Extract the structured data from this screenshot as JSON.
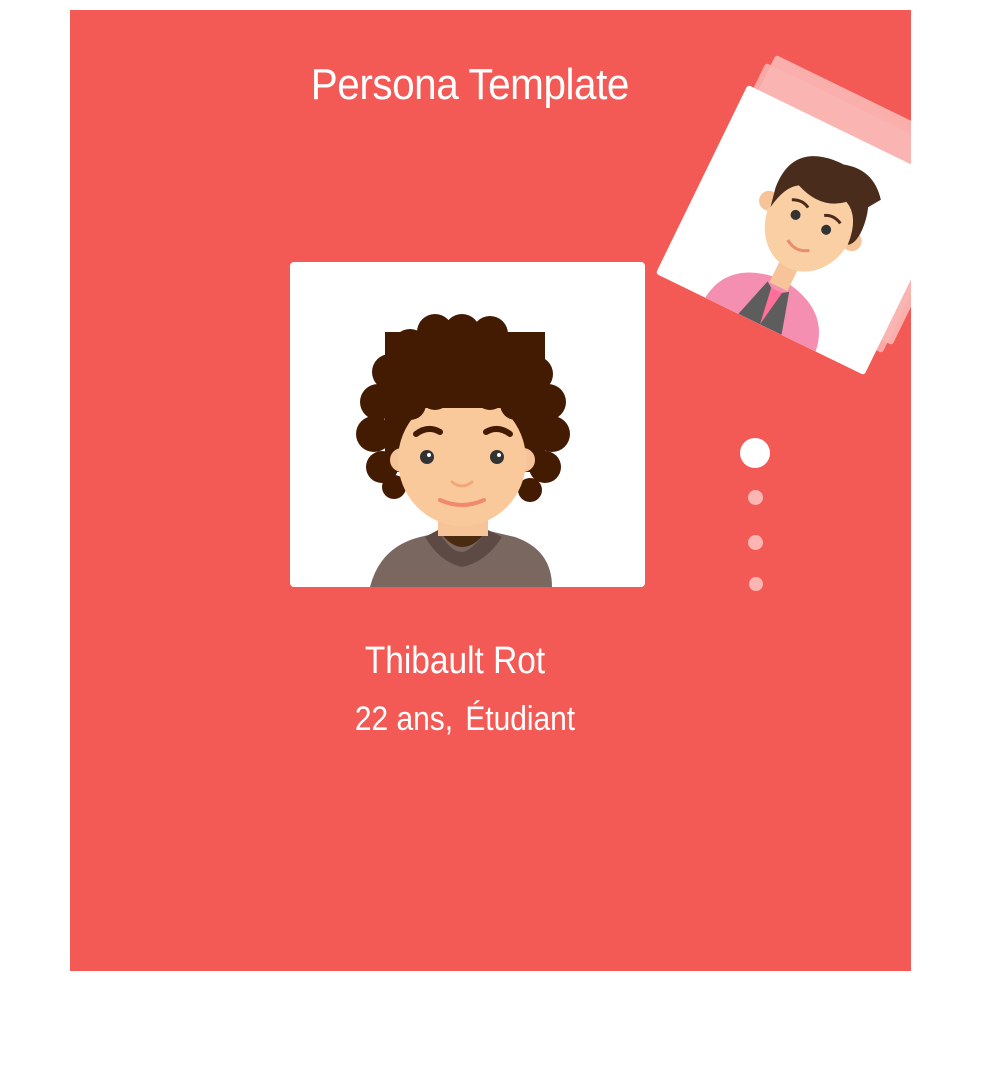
{
  "header": {
    "title": "Persona Template"
  },
  "persona": {
    "name": "Thibault Rot",
    "age": "22 ans,",
    "role": "Étudiant"
  },
  "carousel": {
    "count": 4,
    "active_index": 0
  },
  "colors": {
    "background": "#f35a55",
    "card": "#ffffff",
    "dot_inactive": "#fbb6b3",
    "dot_active": "#ffffff"
  },
  "icons": {
    "main_avatar": "curly-hair-avatar-icon",
    "secondary_avatar": "brown-hair-avatar-icon"
  }
}
